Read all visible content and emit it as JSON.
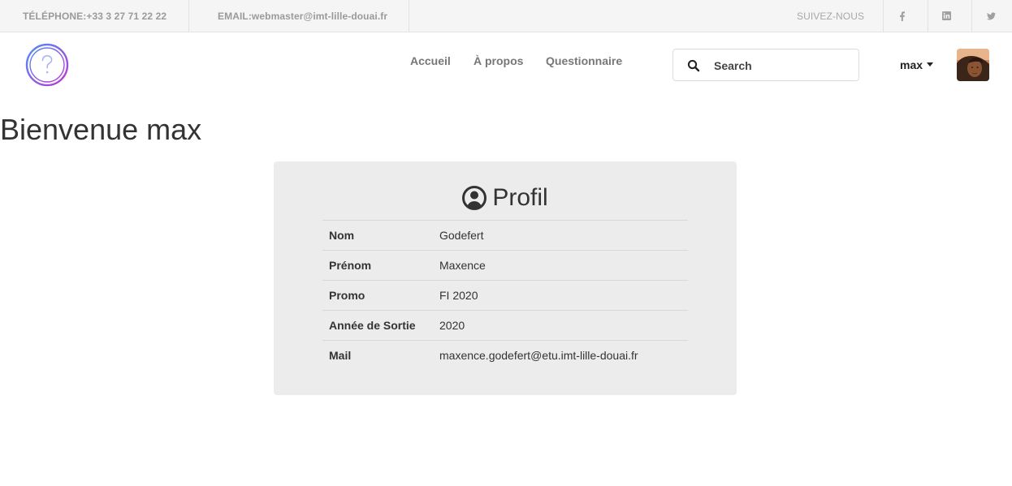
{
  "topbar": {
    "phone": "TÉLÉPHONE:+33 3 27 71 22 22",
    "email": "EMAIL:webmaster@imt-lille-douai.fr",
    "follow": "SUIVEZ-NOUS",
    "social": [
      "facebook-icon",
      "linkedin-icon",
      "twitter-icon"
    ]
  },
  "nav": {
    "links": [
      "Accueil",
      "À propos",
      "Questionnaire"
    ],
    "search_placeholder": "Search",
    "user": "max"
  },
  "main": {
    "welcome": "Bienvenue max",
    "card_title": "Profil",
    "rows": [
      {
        "label": "Nom",
        "value": "Godefert"
      },
      {
        "label": "Prénom",
        "value": "Maxence"
      },
      {
        "label": "Promo",
        "value": "FI 2020"
      },
      {
        "label": "Année de Sortie",
        "value": "2020"
      },
      {
        "label": "Mail",
        "value": "maxence.godefert@etu.imt-lille-douai.fr"
      }
    ]
  },
  "colors": {
    "topbar_bg": "#f5f5f5",
    "card_bg": "#ececec",
    "logo_gradient": [
      "#5b8cf5",
      "#b43bd8"
    ]
  }
}
